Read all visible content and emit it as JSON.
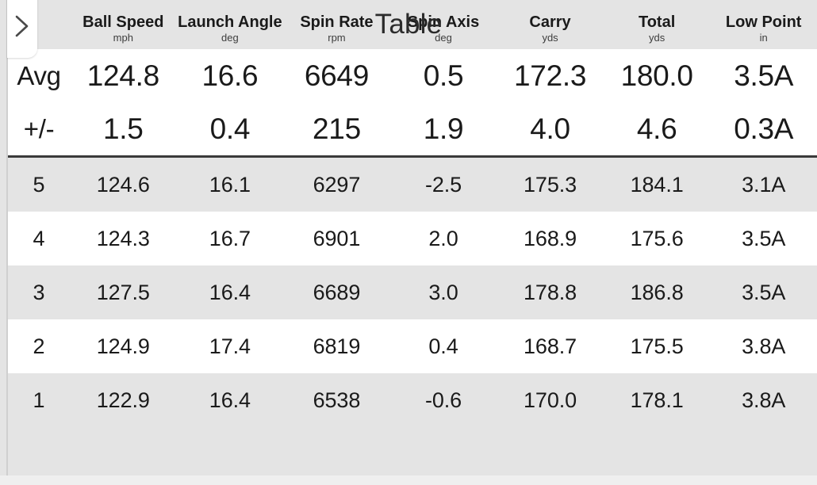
{
  "header": {
    "title": "Table",
    "drawer_toggle_icon": "chevron-right-icon"
  },
  "table": {
    "row_label_header": "",
    "columns": [
      {
        "name": "Ball Speed",
        "unit": "mph"
      },
      {
        "name": "Launch Angle",
        "unit": "deg"
      },
      {
        "name": "Spin Rate",
        "unit": "rpm"
      },
      {
        "name": "Spin Axis",
        "unit": "deg"
      },
      {
        "name": "Carry",
        "unit": "yds"
      },
      {
        "name": "Total",
        "unit": "yds"
      },
      {
        "name": "Low Point",
        "unit": "in"
      }
    ],
    "summary_rows": [
      {
        "label": "Avg",
        "values": [
          "124.8",
          "16.6",
          "6649",
          "0.5",
          "172.3",
          "180.0",
          "3.5A"
        ]
      },
      {
        "label": "+/-",
        "values": [
          "1.5",
          "0.4",
          "215",
          "1.9",
          "4.0",
          "4.6",
          "0.3A"
        ]
      }
    ],
    "shot_rows": [
      {
        "label": "5",
        "values": [
          "124.6",
          "16.1",
          "6297",
          "-2.5",
          "175.3",
          "184.1",
          "3.1A"
        ]
      },
      {
        "label": "4",
        "values": [
          "124.3",
          "16.7",
          "6901",
          "2.0",
          "168.9",
          "175.6",
          "3.5A"
        ]
      },
      {
        "label": "3",
        "values": [
          "127.5",
          "16.4",
          "6689",
          "3.0",
          "178.8",
          "186.8",
          "3.5A"
        ]
      },
      {
        "label": "2",
        "values": [
          "124.9",
          "17.4",
          "6819",
          "0.4",
          "168.7",
          "175.5",
          "3.8A"
        ]
      },
      {
        "label": "1",
        "values": [
          "122.9",
          "16.4",
          "6538",
          "-0.6",
          "170.0",
          "178.1",
          "3.8A"
        ]
      }
    ]
  },
  "colors": {
    "background": "#e4e4e4",
    "row_alt": "#ffffff",
    "text": "#1a1a1a",
    "divider": "#3a3a3a",
    "tab": "#ffffff"
  }
}
